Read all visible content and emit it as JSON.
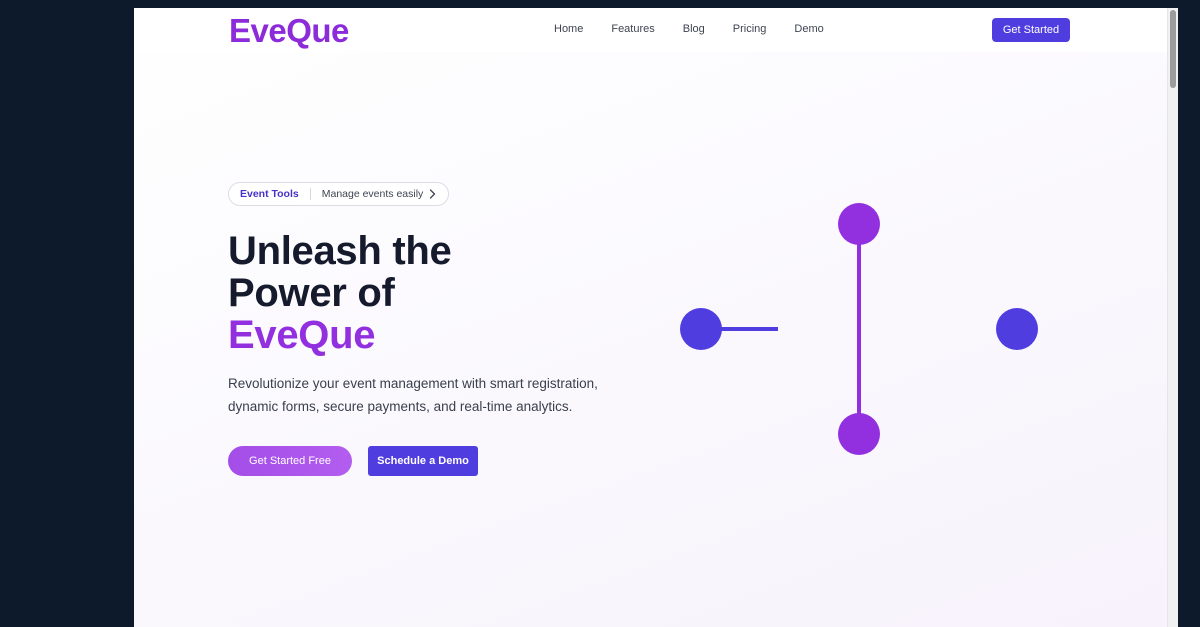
{
  "brand": {
    "logo": "EveQue",
    "accent_color": "#8b2bd9",
    "primary_color": "#4f3de0"
  },
  "nav": {
    "links": [
      "Home",
      "Features",
      "Blog",
      "Pricing",
      "Demo"
    ],
    "cta_label": "Get Started"
  },
  "hero": {
    "badge": {
      "tag": "Event Tools",
      "text": "Manage events easily",
      "icon": "chevron-right-icon"
    },
    "title_lines": [
      "Unleash the",
      "Power of"
    ],
    "title_accent": "EveQue",
    "subtitle": "Revolutionize your event management with smart registration, dynamic forms, secure payments, and real-time analytics.",
    "primary_button": "Get Started Free",
    "secondary_button": "Schedule a Demo"
  },
  "illustration": {
    "node_colors": {
      "purple": "#9230e0",
      "indigo": "#4f3de0"
    },
    "connector_colors": {
      "vertical": "#9230e0",
      "horizontal": "#4f3de0"
    }
  }
}
